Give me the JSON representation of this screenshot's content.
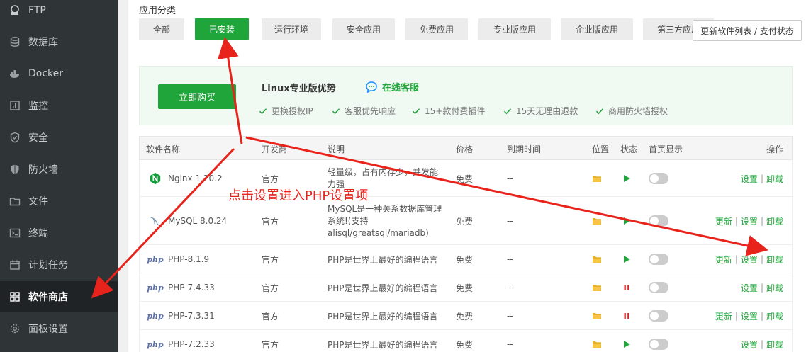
{
  "sidebar": {
    "items": [
      {
        "label": "FTP",
        "icon": "ftp-icon"
      },
      {
        "label": "数据库",
        "icon": "database-icon"
      },
      {
        "label": "Docker",
        "icon": "docker-icon"
      },
      {
        "label": "监控",
        "icon": "monitor-icon"
      },
      {
        "label": "安全",
        "icon": "shield-check-icon"
      },
      {
        "label": "防火墙",
        "icon": "firewall-icon"
      },
      {
        "label": "文件",
        "icon": "folder-icon"
      },
      {
        "label": "终端",
        "icon": "terminal-icon"
      },
      {
        "label": "计划任务",
        "icon": "calendar-icon"
      },
      {
        "label": "软件商店",
        "icon": "grid-icon",
        "active": true
      },
      {
        "label": "面板设置",
        "icon": "gear-icon"
      }
    ]
  },
  "categories": {
    "title": "应用分类",
    "items": [
      "全部",
      "已安装",
      "运行环境",
      "安全应用",
      "免费应用",
      "专业版应用",
      "企业版应用",
      "第三方应用"
    ],
    "active": "已安装",
    "refresh_label": "更新软件列表 / 支付状态"
  },
  "promo": {
    "buy_label": "立即购买",
    "title": "Linux专业版优势",
    "service_label": "在线客服",
    "features": [
      "更换授权IP",
      "客服优先响应",
      "15+款付费插件",
      "15天无理由退款",
      "商用防火墙授权"
    ]
  },
  "table": {
    "headers": {
      "name": "软件名称",
      "dev": "开发商",
      "desc": "说明",
      "price": "价格",
      "expire": "到期时间",
      "pos": "位置",
      "state": "状态",
      "home": "首页显示",
      "ops": "操作"
    },
    "rows": [
      {
        "icon": "nginx-icon",
        "name": "Nginx 1.20.2",
        "dev": "官方",
        "desc": "轻量级，占有内存少，并发能力强",
        "price": "免费",
        "expire": "--",
        "state": "running",
        "ops": [
          "设置",
          "卸载"
        ]
      },
      {
        "icon": "mysql-icon",
        "name": "MySQL 8.0.24",
        "dev": "官方",
        "desc": "MySQL是一种关系数据库管理系统!(支持alisql/greatsql/mariadb)",
        "price": "免费",
        "expire": "--",
        "state": "running",
        "ops": [
          "更新",
          "设置",
          "卸载"
        ]
      },
      {
        "icon": "php-icon",
        "name": "PHP-8.1.9",
        "dev": "官方",
        "desc": "PHP是世界上最好的编程语言",
        "price": "免费",
        "expire": "--",
        "state": "running",
        "ops": [
          "更新",
          "设置",
          "卸载"
        ]
      },
      {
        "icon": "php-icon",
        "name": "PHP-7.4.33",
        "dev": "官方",
        "desc": "PHP是世界上最好的编程语言",
        "price": "免费",
        "expire": "--",
        "state": "stopped",
        "ops": [
          "设置",
          "卸载"
        ]
      },
      {
        "icon": "php-icon",
        "name": "PHP-7.3.31",
        "dev": "官方",
        "desc": "PHP是世界上最好的编程语言",
        "price": "免费",
        "expire": "--",
        "state": "stopped",
        "ops": [
          "更新",
          "设置",
          "卸载"
        ]
      },
      {
        "icon": "php-icon",
        "name": "PHP-7.2.33",
        "dev": "官方",
        "desc": "PHP是世界上最好的编程语言",
        "price": "免费",
        "expire": "--",
        "state": "running",
        "ops": [
          "设置",
          "卸载"
        ]
      }
    ],
    "php_logo_text": "php"
  },
  "annotation": {
    "text": "点击设置进入PHP设置项",
    "color": "#e8231b"
  },
  "colors": {
    "accent": "#20a53a",
    "sidebar_bg": "#2f3437"
  }
}
